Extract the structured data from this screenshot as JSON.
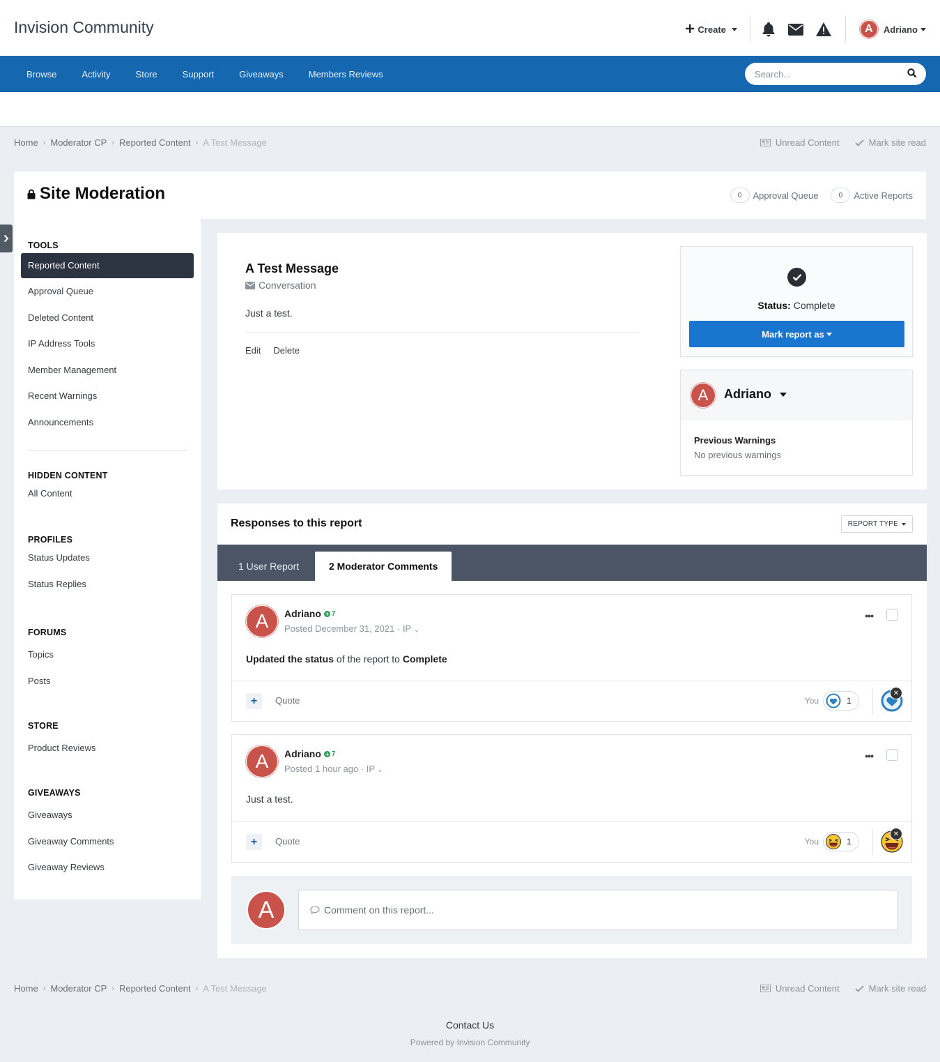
{
  "header": {
    "site_title": "Invision Community",
    "create_label": "Create",
    "user_name": "Adriano",
    "avatar_letter": "A",
    "icons": [
      "bell-icon",
      "envelope-icon",
      "warning-icon"
    ]
  },
  "nav": {
    "items": [
      "Browse",
      "Activity",
      "Store",
      "Support",
      "Giveaways",
      "Members Reviews"
    ],
    "search_placeholder": "Search..."
  },
  "breadcrumb": {
    "items": [
      "Home",
      "Moderator CP",
      "Reported Content"
    ],
    "current": "A Test Message",
    "unread": "Unread Content",
    "mark_read": "Mark site read"
  },
  "panel": {
    "title": "Site Moderation",
    "approval_count": "0",
    "approval_label": "Approval Queue",
    "reports_count": "0",
    "reports_label": "Active Reports"
  },
  "sidebar": {
    "tools_heading": "TOOLS",
    "tools": [
      "Reported Content",
      "Approval Queue",
      "Deleted Content",
      "IP Address Tools",
      "Member Management",
      "Recent Warnings",
      "Announcements"
    ],
    "hidden_heading": "HIDDEN CONTENT",
    "hidden": [
      "All Content"
    ],
    "profiles_heading": "PROFILES",
    "profiles": [
      "Status Updates",
      "Status Replies"
    ],
    "forums_heading": "FORUMS",
    "forums": [
      "Topics",
      "Posts"
    ],
    "store_heading": "STORE",
    "store": [
      "Product Reviews"
    ],
    "giveaways_heading": "GIVEAWAYS",
    "giveaways": [
      "Giveaways",
      "Giveaway Comments",
      "Giveaway Reviews"
    ]
  },
  "message": {
    "title": "A Test Message",
    "type": "Conversation",
    "body": "Just a test.",
    "edit": "Edit",
    "delete": "Delete"
  },
  "status": {
    "label": "Status:",
    "value": "Complete",
    "button": "Mark report as"
  },
  "reported_user": {
    "name": "Adriano",
    "avatar_letter": "A",
    "warnings_title": "Previous Warnings",
    "warnings_text": "No previous warnings"
  },
  "responses": {
    "title": "Responses to this report",
    "report_type": "REPORT TYPE",
    "tabs": [
      "1 User Report",
      "2 Moderator Comments"
    ],
    "comments": [
      {
        "author": "Adriano",
        "rep": "7",
        "meta": "Posted December 31, 2021 · IP",
        "body_b1": "Updated the status",
        "body_mid": " of the report to ",
        "body_b2": "Complete",
        "quote": "Quote",
        "you": "You",
        "reaction": "like",
        "reaction_count": "1"
      },
      {
        "author": "Adriano",
        "rep": "7",
        "meta": "Posted 1 hour ago · IP",
        "body": "Just a test.",
        "quote": "Quote",
        "you": "You",
        "reaction": "haha",
        "reaction_count": "1"
      }
    ],
    "compose_placeholder": "Comment on this report..."
  },
  "footer": {
    "contact": "Contact Us",
    "powered": "Powered by Invision Community"
  },
  "colors": {
    "brand_blue": "#1568b0",
    "button_blue": "#1a75cf",
    "tab_bar": "#4b5566",
    "avatar": "#c9534b",
    "active_sidebar": "#2c3441"
  }
}
